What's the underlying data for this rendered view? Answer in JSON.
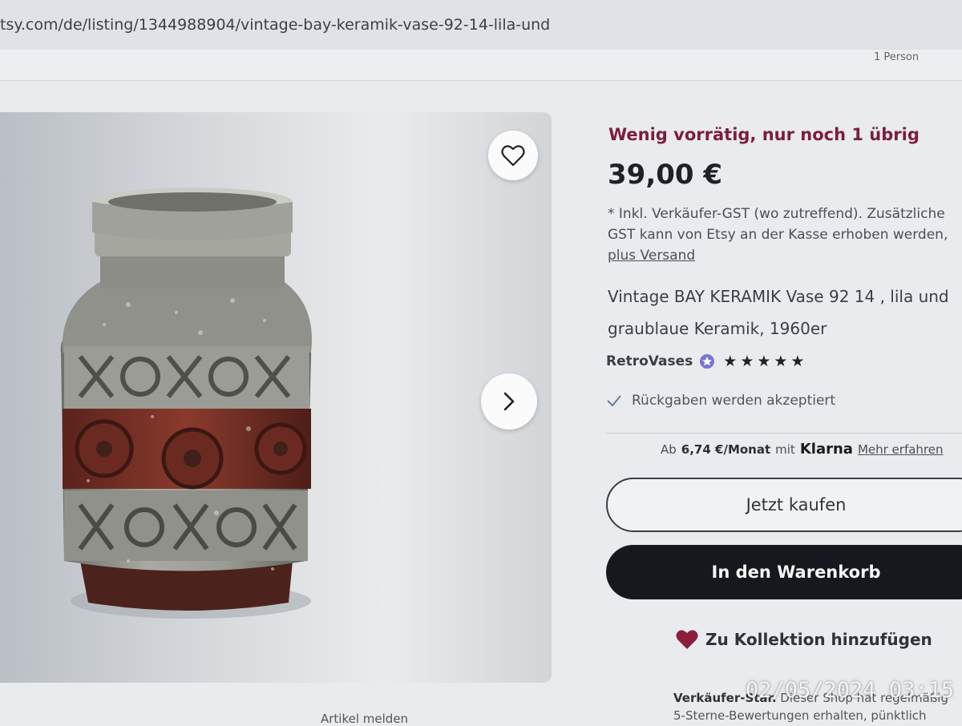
{
  "browser": {
    "url": "tsy.com/de/listing/1344988904/vintage-bay-keramik-vase-92-14-lila-und"
  },
  "topStrip": {
    "partialText": "1 Person"
  },
  "gallery": {
    "favoriteIcon": "heart-outline-icon",
    "nextIcon": "chevron-right-icon"
  },
  "listing": {
    "stock": "Wenig vorrätig, nur noch 1 übrig",
    "price": "39,00 €",
    "taxNote": "* Inkl. Verkäufer-GST (wo zutreffend). Zusätzliche GST kann von Etsy an der Kasse erhoben werden,",
    "shippingLink": "plus Versand",
    "title": "Vintage BAY KERAMIK Vase 92 14 , lila und graublaue Keramik, 1960er",
    "shopName": "RetroVases",
    "stars": "★★★★★",
    "rating": 5,
    "returns": "Rückgaben werden akzeptiert",
    "klarna": {
      "prefix": "Ab",
      "amount": "6,74 €/Monat",
      "with": "mit",
      "brand": "Klarna",
      "link": "Mehr erfahren"
    },
    "buyNow": "Jetzt kaufen",
    "addToCart": "In den Warenkorb",
    "addToCollection": "Zu Kollektion hinzufügen",
    "sellerNoteBold": "Verkäufer-Star.",
    "sellerNote1": "Dieser Shop hat regelmäßig",
    "sellerNote2": "5-Sterne-Bewertungen erhalten, pünktlich"
  },
  "bottom": {
    "reportText": "Artikel melden"
  },
  "timestamp": "02/05/2024  03:15",
  "colors": {
    "stockAccent": "#7b1e3c",
    "cartButton": "#15191e",
    "heartFill": "#8a1f3d",
    "badge": "#7a74d6"
  }
}
